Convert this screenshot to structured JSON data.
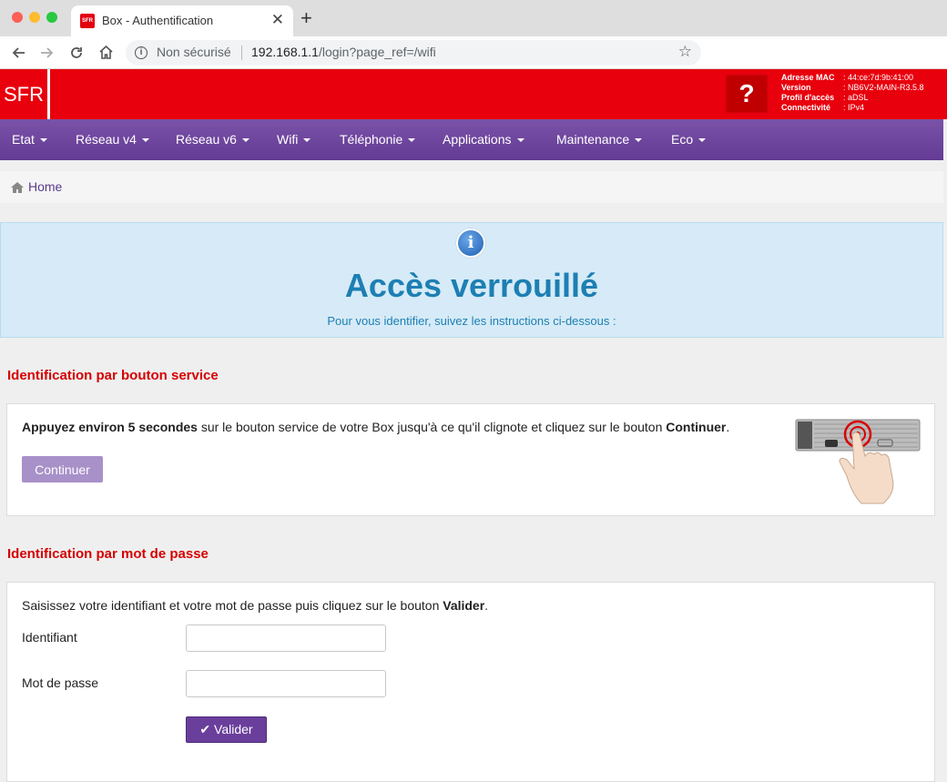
{
  "browser": {
    "tab_title": "Box - Authentification",
    "favicon_text": "SFR",
    "close_glyph": "✕",
    "new_tab_glyph": "+",
    "security_label": "Non sécurisé",
    "url_host": "192.168.1.1",
    "url_path": "/login?page_ref=/wifi"
  },
  "header": {
    "logo": "SFR",
    "help_glyph": "?",
    "device_info": [
      {
        "label": "Adresse MAC",
        "value": ": 44:ce:7d:9b:41:00"
      },
      {
        "label": "Version",
        "value": ": NB6V2-MAIN-R3.5.8"
      },
      {
        "label": "Profil d'accès",
        "value": ": aDSL"
      },
      {
        "label": "Connectivité",
        "value": ": IPv4"
      }
    ]
  },
  "menu": {
    "items": [
      "Etat",
      "Réseau v4",
      "Réseau v6",
      "Wifi",
      "Téléphonie",
      "Applications",
      "Maintenance",
      "Eco"
    ]
  },
  "breadcrumb": {
    "home": "Home"
  },
  "alert": {
    "title": "Accès verrouillé",
    "subtitle": "Pour vous identifier, suivez les instructions ci-dessous :"
  },
  "service_section": {
    "title": "Identification par bouton service",
    "instr_bold1": "Appuyez environ 5 secondes",
    "instr_mid": " sur le bouton service de votre Box jusqu'à ce qu'il clignote et cliquez sur le bouton ",
    "instr_bold2": "Continuer",
    "instr_end": ".",
    "button": "Continuer"
  },
  "password_section": {
    "title": "Identification par mot de passe",
    "instr_start": "Saisissez votre identifiant et votre mot de passe puis cliquez sur le bouton ",
    "instr_bold": "Valider",
    "instr_end": ".",
    "label_id": "Identifiant",
    "label_pwd": "Mot de passe",
    "button": "Valider"
  },
  "colors": {
    "sfr_red": "#e8000d",
    "menu_purple": "#643b94",
    "alert_blue": "#1d7fb3",
    "section_red": "#d60000"
  }
}
